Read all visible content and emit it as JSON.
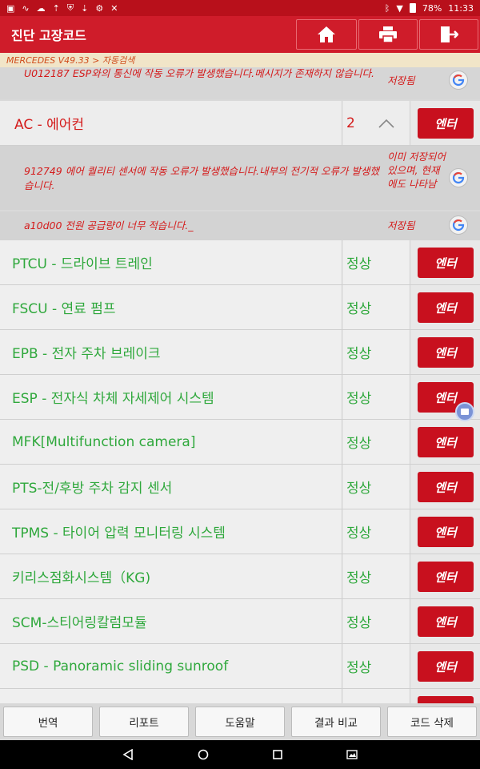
{
  "status_bar": {
    "battery": "78%",
    "time": "11:33"
  },
  "app_bar": {
    "title": "진단 고장코드",
    "buttons": [
      "home-icon",
      "print-icon",
      "exit-icon"
    ]
  },
  "breadcrumb": "MERCEDES V49.33 > 자동검색",
  "dtcs_top": [
    {
      "message": "U012187 ESP와의 통신에 작동 오류가 발생했습니다.메시지가 존재하지 않습니다.",
      "status": "저장됨"
    }
  ],
  "expanded_system": {
    "name": "AC - 에어컨",
    "count": "2",
    "enter_label": "엔터",
    "dtcs": [
      {
        "message": "912749 에어 퀄리티 센서에 작동 오류가 발생했습니다.내부의  전기적 오류가 발생했습니다.",
        "status": "이미 저장되어 있으며, 현재에도 나타남"
      },
      {
        "message": "a10d00 전원 공급량이 너무 적습니다._",
        "status": "저장됨"
      }
    ]
  },
  "systems": [
    {
      "name": "PTCU - 드라이브 트레인",
      "state": "정상",
      "enter_label": "엔터"
    },
    {
      "name": "FSCU - 연료 펌프",
      "state": "정상",
      "enter_label": "엔터"
    },
    {
      "name": "EPB - 전자 주차 브레이크",
      "state": "정상",
      "enter_label": "엔터"
    },
    {
      "name": "ESP - 전자식 차체 자세제어 시스템",
      "state": "정상",
      "enter_label": "엔터"
    },
    {
      "name": "MFK[Multifunction camera]",
      "state": "정상",
      "enter_label": "엔터"
    },
    {
      "name": "PTS-전/후방 주차 감지 센서",
      "state": "정상",
      "enter_label": "엔터"
    },
    {
      "name": "TPMS - 타이어 압력 모니터링 시스템",
      "state": "정상",
      "enter_label": "엔터"
    },
    {
      "name": "키리스점화시스템（KG)",
      "state": "정상",
      "enter_label": "엔터"
    },
    {
      "name": "SCM-스티어링칼럼모듈",
      "state": "정상",
      "enter_label": "엔터"
    },
    {
      "name": "PSD - Panoramic sliding sunroof",
      "state": "정상",
      "enter_label": "엔터"
    }
  ],
  "bottom_bar": [
    "번역",
    "리포트",
    "도움말",
    "결과 비교",
    "코드 삭제"
  ],
  "colors": {
    "brand_red": "#cf1c2a",
    "ok_green": "#2fa83c",
    "fault_red": "#d41a1a"
  }
}
